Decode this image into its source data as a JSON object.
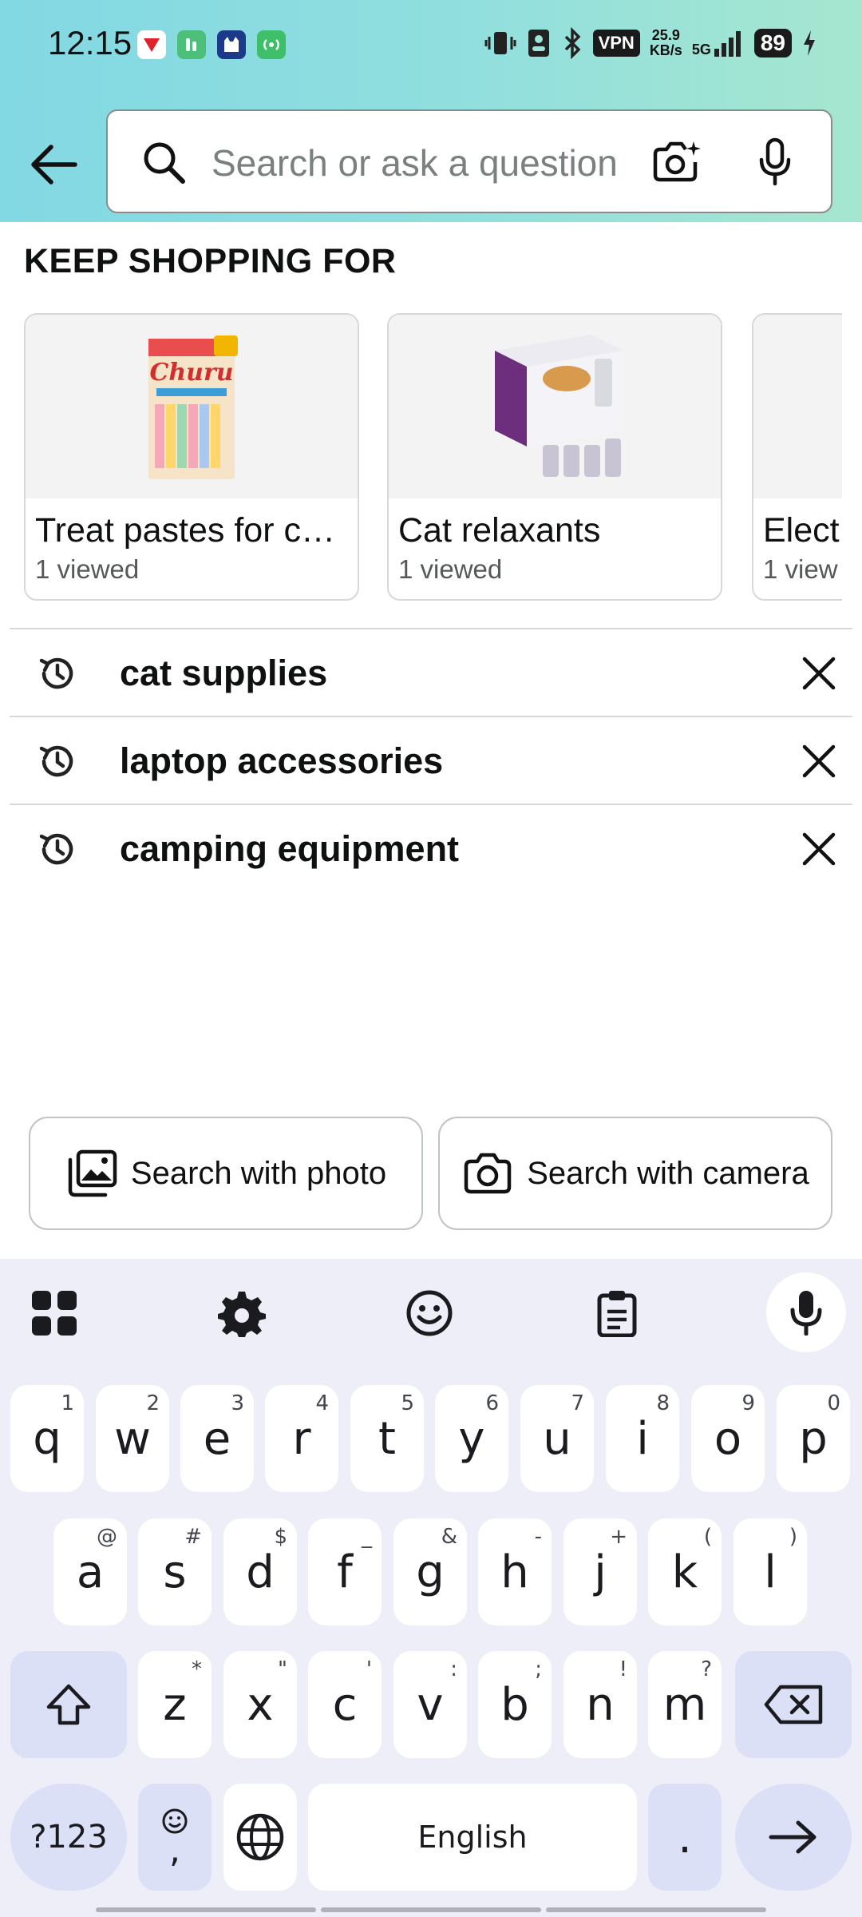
{
  "status_bar": {
    "time": "12:15",
    "vpn": "VPN",
    "net_speed_value": "25.9",
    "net_speed_unit": "KB/s",
    "network": "5G",
    "battery": "89"
  },
  "search": {
    "placeholder": "Search or ask a question"
  },
  "keep_shopping": {
    "title": "KEEP SHOPPING FOR",
    "cards": [
      {
        "title": "Treat pastes for c…",
        "subtitle": "1 viewed"
      },
      {
        "title": "Cat relaxants",
        "subtitle": "1 viewed"
      },
      {
        "title": "Elect",
        "subtitle": "1 view"
      }
    ]
  },
  "history": {
    "items": [
      {
        "label": "cat supplies"
      },
      {
        "label": "laptop accessories"
      },
      {
        "label": "camping equipment"
      }
    ]
  },
  "visual_search": {
    "photo_label": "Search with photo",
    "camera_label": "Search with camera"
  },
  "keyboard": {
    "row1": [
      {
        "key": "q",
        "hint": "1"
      },
      {
        "key": "w",
        "hint": "2"
      },
      {
        "key": "e",
        "hint": "3"
      },
      {
        "key": "r",
        "hint": "4"
      },
      {
        "key": "t",
        "hint": "5"
      },
      {
        "key": "y",
        "hint": "6"
      },
      {
        "key": "u",
        "hint": "7"
      },
      {
        "key": "i",
        "hint": "8"
      },
      {
        "key": "o",
        "hint": "9"
      },
      {
        "key": "p",
        "hint": "0"
      }
    ],
    "row2": [
      {
        "key": "a",
        "hint": "@"
      },
      {
        "key": "s",
        "hint": "#"
      },
      {
        "key": "d",
        "hint": "$"
      },
      {
        "key": "f",
        "hint": "_"
      },
      {
        "key": "g",
        "hint": "&"
      },
      {
        "key": "h",
        "hint": "-"
      },
      {
        "key": "j",
        "hint": "+"
      },
      {
        "key": "k",
        "hint": "("
      },
      {
        "key": "l",
        "hint": ")"
      }
    ],
    "row3": [
      {
        "key": "z",
        "hint": "*"
      },
      {
        "key": "x",
        "hint": "\""
      },
      {
        "key": "c",
        "hint": "'"
      },
      {
        "key": "v",
        "hint": ":"
      },
      {
        "key": "b",
        "hint": ";"
      },
      {
        "key": "n",
        "hint": "!"
      },
      {
        "key": "m",
        "hint": "?"
      }
    ],
    "symbols_label": "?123",
    "comma_label": ",",
    "space_label": "English",
    "period_label": "."
  },
  "colors": {
    "header_gradient_start": "#82d8e3",
    "header_gradient_end": "#a6e6cf",
    "keyboard_bg": "#edeef7",
    "function_key": "#dbe0f7"
  }
}
